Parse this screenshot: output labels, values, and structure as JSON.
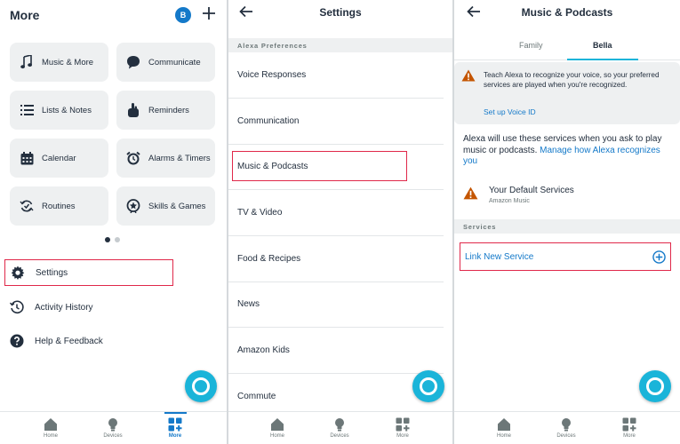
{
  "more": {
    "title": "More",
    "avatar_initial": "B",
    "tiles": [
      {
        "label": "Music & More",
        "icon": "music-note-icon"
      },
      {
        "label": "Communicate",
        "icon": "chat-bubble-icon"
      },
      {
        "label": "Lists & Notes",
        "icon": "list-icon"
      },
      {
        "label": "Reminders",
        "icon": "reminder-hand-icon"
      },
      {
        "label": "Calendar",
        "icon": "calendar-icon"
      },
      {
        "label": "Alarms & Timers",
        "icon": "alarm-clock-icon"
      },
      {
        "label": "Routines",
        "icon": "routines-icon"
      },
      {
        "label": "Skills & Games",
        "icon": "skills-icon"
      }
    ],
    "menu": [
      {
        "label": "Settings",
        "icon": "gear-icon"
      },
      {
        "label": "Activity History",
        "icon": "history-icon"
      },
      {
        "label": "Help & Feedback",
        "icon": "help-icon"
      }
    ]
  },
  "settings": {
    "title": "Settings",
    "section": "Alexa Preferences",
    "items": [
      "Voice Responses",
      "Communication",
      "Music & Podcasts",
      "TV & Video",
      "Food & Recipes",
      "News",
      "Amazon Kids",
      "Commute"
    ]
  },
  "music": {
    "title": "Music & Podcasts",
    "tabs": [
      "Family",
      "Bella"
    ],
    "alert_text": "Teach Alexa to recognize your voice, so your preferred services are played when you're recognized.",
    "alert_link": "Set up Voice ID",
    "info_text": "Alexa will use these services when you ask to play music or podcasts.",
    "info_link": "Manage how Alexa recognizes you",
    "default_title": "Your Default Services",
    "default_sub": "Amazon Music",
    "services_section": "Services",
    "link_service": "Link New Service"
  },
  "nav": {
    "home": "Home",
    "devices": "Devices",
    "more": "More"
  },
  "colors": {
    "accent": "#1479c9",
    "alexa": "#1ab4d9",
    "highlight": "#e0284a",
    "warning": "#c45500"
  }
}
